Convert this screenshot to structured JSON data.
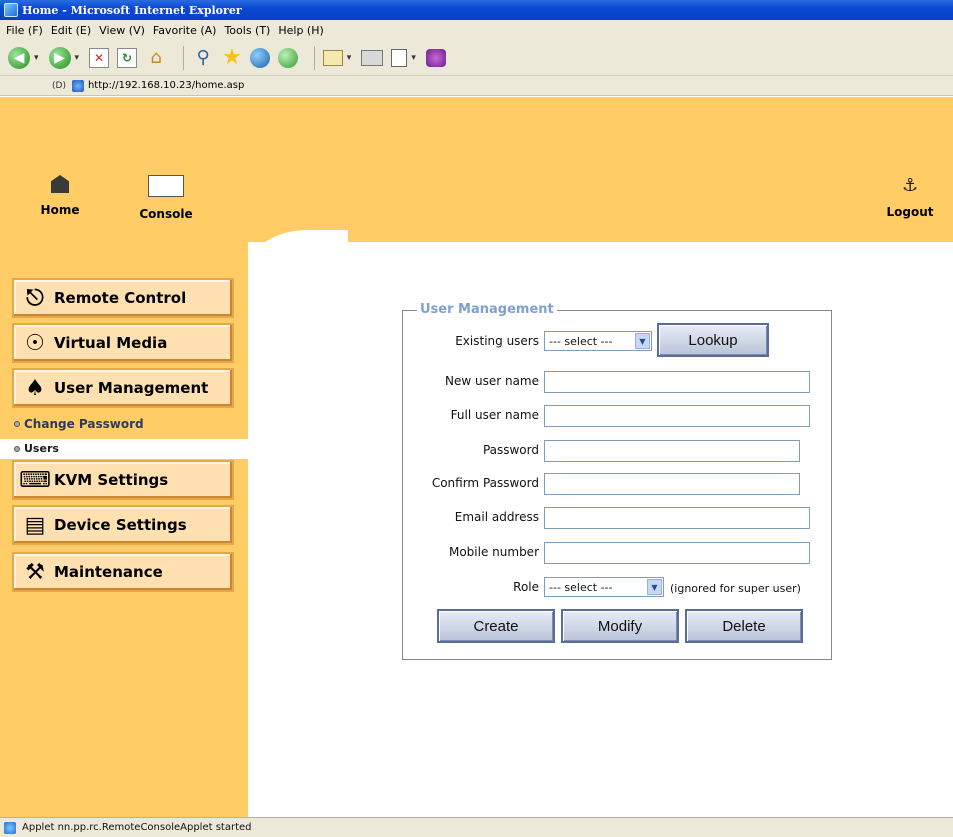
{
  "window": {
    "title": "Home - Microsoft Internet Explorer"
  },
  "menubar": {
    "items": [
      "File (F)",
      "Edit (E)",
      "View (V)",
      "Favorite (A)",
      "Tools (T)",
      "Help (H)"
    ]
  },
  "address": {
    "label": "(D)",
    "url": "http://192.168.10.23/home.asp"
  },
  "header": {
    "home_label": "Home",
    "console_label": "Console",
    "logout_label": "Logout"
  },
  "sidebar": {
    "remote_control": "Remote Control",
    "virtual_media": "Virtual Media",
    "user_management": "User Management",
    "change_password": "Change Password",
    "users": "Users",
    "kvm_settings": "KVM Settings",
    "device_settings": "Device Settings",
    "maintenance": "Maintenance"
  },
  "form": {
    "legend": "User Management",
    "existing_users_label": "Existing users",
    "existing_users_value": "--- select ---",
    "lookup_label": "Lookup",
    "new_user_label": "New user name",
    "full_user_label": "Full user name",
    "password_label": "Password",
    "confirm_password_label": "Confirm Password",
    "email_label": "Email address",
    "mobile_label": "Mobile number",
    "role_label": "Role",
    "role_value": "--- select ---",
    "role_note": "(ignored for super user)",
    "create_label": "Create",
    "modify_label": "Modify",
    "delete_label": "Delete"
  },
  "status": {
    "text": "Applet nn.pp.rc.RemoteConsoleApplet started"
  },
  "colors": {
    "accent": "#ffcc66",
    "title_blue": "#0a4ad6",
    "legend": "#7f9fd0"
  }
}
